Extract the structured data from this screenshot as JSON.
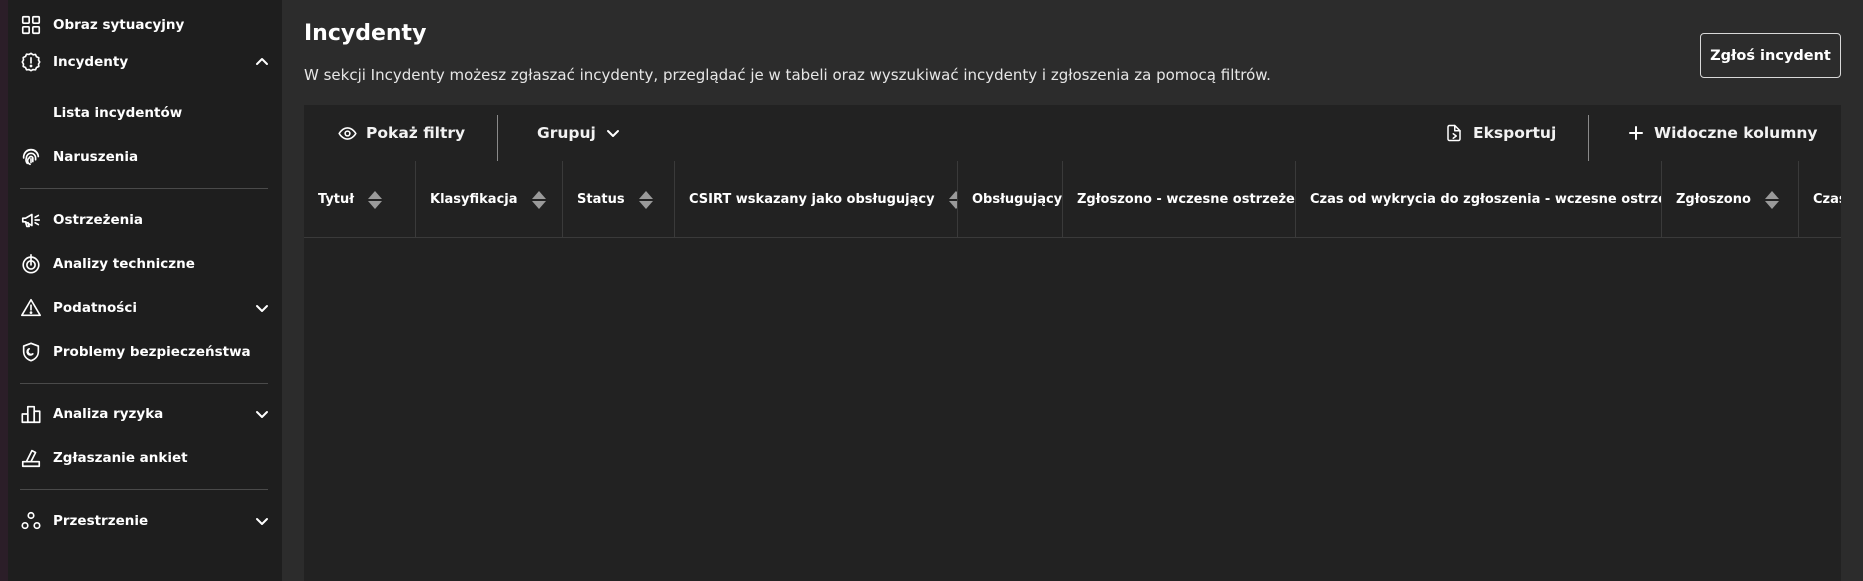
{
  "sidebar": {
    "items": [
      {
        "label": "Obraz sytuacyjny",
        "icon": "dashboard-icon"
      },
      {
        "label": "Incydenty",
        "icon": "alert-gear-icon",
        "expanded": true
      },
      {
        "label": "Lista incydentów",
        "sub": true
      },
      {
        "label": "Naruszenia",
        "icon": "fingerprint-icon"
      },
      {
        "label": "Ostrzeżenia",
        "icon": "megaphone-icon"
      },
      {
        "label": "Analizy techniczne",
        "icon": "target-icon"
      },
      {
        "label": "Podatności",
        "icon": "warning-triangle-icon",
        "expanded": false
      },
      {
        "label": "Problemy bezpieczeństwa",
        "icon": "shield-icon"
      },
      {
        "label": "Analiza ryzyka",
        "icon": "bar-chart-icon",
        "expanded": false
      },
      {
        "label": "Zgłaszanie ankiet",
        "icon": "survey-icon"
      },
      {
        "label": "Przestrzenie",
        "icon": "spaces-icon",
        "expanded": false
      }
    ]
  },
  "main": {
    "title": "Incydenty",
    "description": "W sekcji Incydenty możesz zgłaszać incydenty, przeglądać je w tabeli oraz wyszukiwać incydenty i zgłoszenia za pomocą filtrów.",
    "report_button": "Zgłoś incydent"
  },
  "toolbar": {
    "show_filters": "Pokaż filtry",
    "group": "Grupuj",
    "export": "Eksportuj",
    "visible_columns": "Widoczne kolumny"
  },
  "table": {
    "columns": [
      "Tytuł",
      "Klasyfikacja",
      "Status",
      "CSIRT wskazany jako obsługujący",
      "Obsługujący",
      "Zgłoszono - wczesne ostrzeżenie",
      "Czas od wykrycia do zgłoszenia - wczesne ostrzeżenie",
      "Zgłoszono",
      "Czas"
    ],
    "rows": []
  },
  "colors": {
    "sidebar_bg": "#1e1e1e",
    "main_bg": "#2c2c2c",
    "panel_bg": "#222222",
    "text": "#ffffff"
  }
}
